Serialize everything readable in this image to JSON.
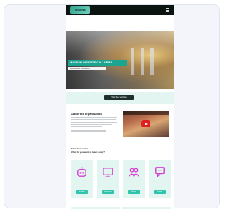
{
  "site": {
    "logo_text": "ARCHIVES",
    "hero_title": "MUSEUM WEBSITE GALLERIES",
    "hero_subtitle": "Explore the collection",
    "cta_label": "Visit the website",
    "section_title": "About the organisation",
    "subsection_title": "Education centre",
    "subsection_line": "What do you want to learn today?",
    "tiles": [
      {
        "icon": "robot-icon",
        "label": "Activities"
      },
      {
        "icon": "monitor-icon",
        "label": "Resources"
      },
      {
        "icon": "people-icon",
        "label": "Groups"
      },
      {
        "icon": "chat-icon",
        "label": "Contact"
      }
    ]
  },
  "colors": {
    "accent": "#2ec4ac",
    "icon_magenta": "#d63ed0",
    "band": "#e2f5f1",
    "topbar": "#0c1412"
  }
}
